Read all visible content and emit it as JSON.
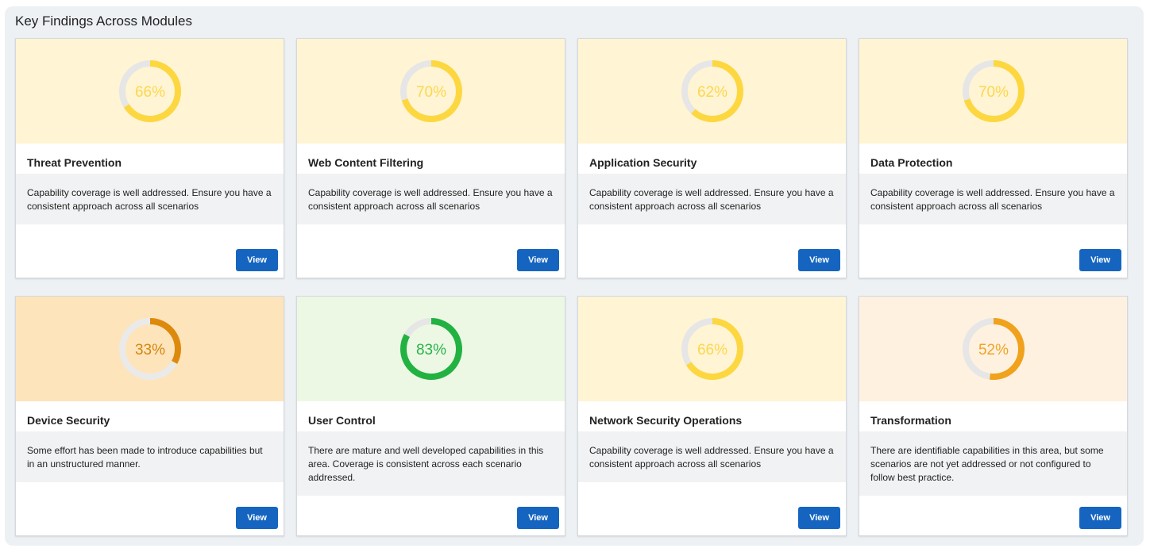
{
  "panel": {
    "title": "Key Findings Across Modules"
  },
  "action_label": "View",
  "cards": [
    {
      "title": "Threat Prevention",
      "percent": 66,
      "percent_label": "66%",
      "description": "Capability coverage is well addressed. Ensure you have a consistent approach across all scenarios",
      "bg": "#fff4d4",
      "ring": "#fdd73f",
      "track": "#e6e6e6",
      "text_color": "#fcd84d"
    },
    {
      "title": "Web Content Filtering",
      "percent": 70,
      "percent_label": "70%",
      "description": "Capability coverage is well addressed. Ensure you have a consistent approach across all scenarios",
      "bg": "#fff4d4",
      "ring": "#fdd73f",
      "track": "#e6e6e6",
      "text_color": "#fcd84d"
    },
    {
      "title": "Application Security",
      "percent": 62,
      "percent_label": "62%",
      "description": "Capability coverage is well addressed. Ensure you have a consistent approach across all scenarios",
      "bg": "#fff4d4",
      "ring": "#fdd73f",
      "track": "#e6e6e6",
      "text_color": "#fcd84d"
    },
    {
      "title": "Data Protection",
      "percent": 70,
      "percent_label": "70%",
      "description": "Capability coverage is well addressed. Ensure you have a consistent approach across all scenarios",
      "bg": "#fff4d4",
      "ring": "#fdd73f",
      "track": "#e6e6e6",
      "text_color": "#fcd84d"
    },
    {
      "title": "Device Security",
      "percent": 33,
      "percent_label": "33%",
      "description": "Some effort has been made to introduce capabilities but in an unstructured manner.",
      "bg": "#fee4bb",
      "ring": "#dd8a0c",
      "track": "#eaeaea",
      "text_color": "#d4860f"
    },
    {
      "title": "User Control",
      "percent": 83,
      "percent_label": "83%",
      "description": "There are mature and well developed capabilities in this area. Coverage is consistent across each scenario addressed.",
      "bg": "#ecf8e4",
      "ring": "#22b241",
      "track": "#e6e6e6",
      "text_color": "#2bb34a"
    },
    {
      "title": "Network Security Operations",
      "percent": 66,
      "percent_label": "66%",
      "description": "Capability coverage is well addressed. Ensure you have a consistent approach across all scenarios",
      "bg": "#fff4d4",
      "ring": "#fdd73f",
      "track": "#e6e6e6",
      "text_color": "#fcd84d"
    },
    {
      "title": "Transformation",
      "percent": 52,
      "percent_label": "52%",
      "description": "There are identifiable capabilities in this area, but some scenarios are not yet addressed or not configured to follow best practice.",
      "bg": "#fff1e0",
      "ring": "#f0a21c",
      "track": "#e6e6e6",
      "text_color": "#f0a424"
    }
  ]
}
